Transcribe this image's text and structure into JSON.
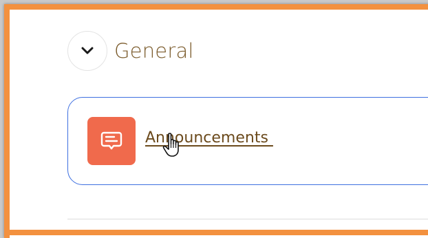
{
  "section": {
    "title": "General",
    "collapse_icon": "chevron-down-icon"
  },
  "activity": {
    "label": "Announcements ",
    "icon": "forum-icon",
    "icon_color": "#f06a4c"
  },
  "colors": {
    "frame_highlight": "#f3913f",
    "card_border": "#3d6fe0",
    "title_text": "#7a5a2a",
    "link_text": "#6b4a1c"
  }
}
